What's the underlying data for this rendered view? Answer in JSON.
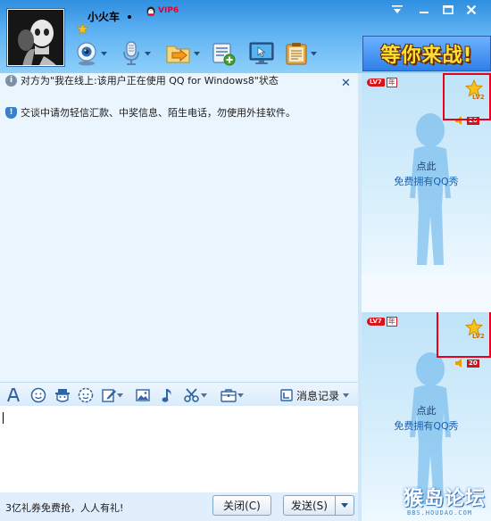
{
  "header": {
    "nickname": "小火车",
    "vip_label": "VIP6",
    "window_buttons": [
      "menu",
      "minimize",
      "maximize",
      "close"
    ]
  },
  "toolbar": {
    "items": [
      {
        "name": "video-chat",
        "icon": "webcam-icon",
        "has_dropdown": true
      },
      {
        "name": "voice-chat",
        "icon": "microphone-icon",
        "has_dropdown": true
      },
      {
        "name": "send-file",
        "icon": "folder-arrow-icon",
        "has_dropdown": true
      },
      {
        "name": "send-sms",
        "icon": "sms-icon",
        "has_dropdown": false
      },
      {
        "name": "remote-assist",
        "icon": "monitor-icon",
        "has_dropdown": false
      },
      {
        "name": "apps",
        "icon": "clipboard-icon",
        "has_dropdown": true
      }
    ]
  },
  "banner": {
    "text": "等你来战!"
  },
  "messages": {
    "online_notice": "对方为\"我在线上:该用户正在使用 QQ for Windows8\"状态",
    "security_notice": "交谈中请勿轻信汇款、中奖信息、陌生电话，勿使用外挂软件。"
  },
  "format_toolbar": {
    "history_label": "消息记录"
  },
  "input": {
    "value": ""
  },
  "bottom": {
    "ad_text": "3亿礼券免费抢，人人有礼!",
    "close_label": "关闭(C)",
    "send_label": "发送(S)"
  },
  "qq_show": {
    "friend": {
      "level": "LV7",
      "year": "年",
      "star_level": "LV2",
      "volume": "20",
      "line1": "点此",
      "line2": "免费拥有QQ秀"
    },
    "self": {
      "level": "LV7",
      "year": "年",
      "star_level": "LV2",
      "volume": "20",
      "line1": "点此",
      "line2": "免费拥有QQ秀"
    }
  },
  "watermark": {
    "title": "猴岛论坛",
    "url": "BBS.HOUDAO.COM"
  },
  "colors": {
    "header_top": "#2f8fe0",
    "accent_red": "#e8001c",
    "link_blue": "#1560b8"
  }
}
